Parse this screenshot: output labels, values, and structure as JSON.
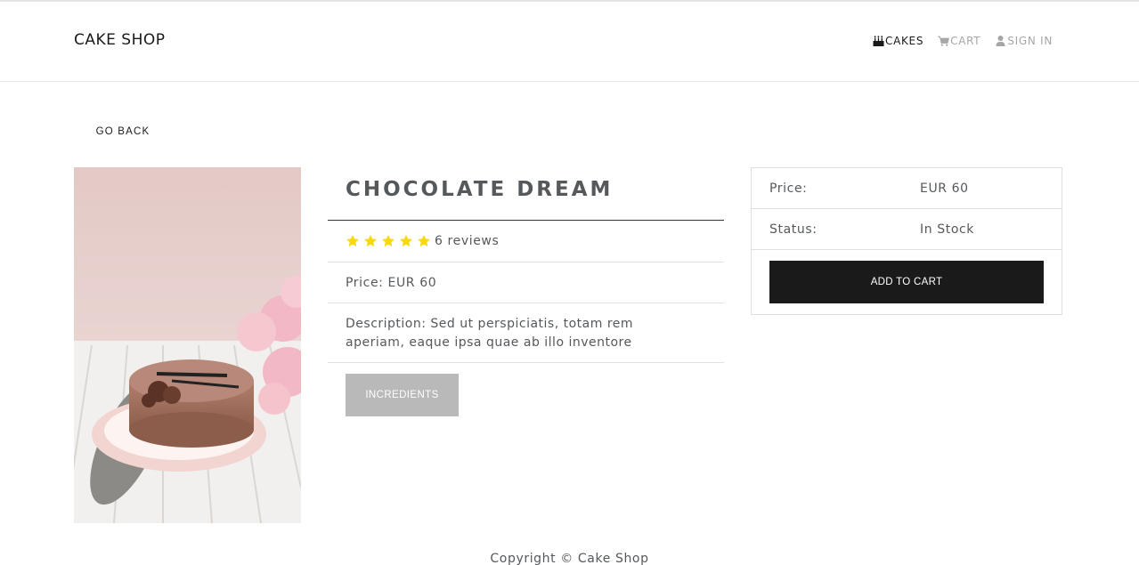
{
  "header": {
    "brand": "CAKE SHOP",
    "nav": [
      {
        "label": "CAKES",
        "icon": "birthday-cake-icon",
        "active": true
      },
      {
        "label": "CART",
        "icon": "cart-icon",
        "active": false
      },
      {
        "label": "SIGN IN",
        "icon": "user-icon",
        "active": false
      }
    ]
  },
  "go_back": "GO BACK",
  "product": {
    "image_description": "chocolate cake with frosting rose on a plate with pink flowers",
    "name": "CHOCOLATE DREAM",
    "rating": 5,
    "reviews_text": "6 reviews",
    "price_line": "Price: EUR 60",
    "description": "Description: Sed ut perspiciatis, totam rem aperiam, eaque ipsa quae ab illo inventore",
    "ingredients_label": "INCREDIENTS"
  },
  "cart_card": {
    "price_label": "Price:",
    "price_value": "EUR 60",
    "status_label": "Status:",
    "status_value": "In Stock",
    "add_to_cart": "ADD TO CART"
  },
  "footer": {
    "copyright": "Copyright © Cake Shop"
  },
  "colors": {
    "star": "#f8d90f",
    "primary_button": "#1a1a1a",
    "disabled_button": "#b9b9b9",
    "accent_text": "#55595c"
  }
}
